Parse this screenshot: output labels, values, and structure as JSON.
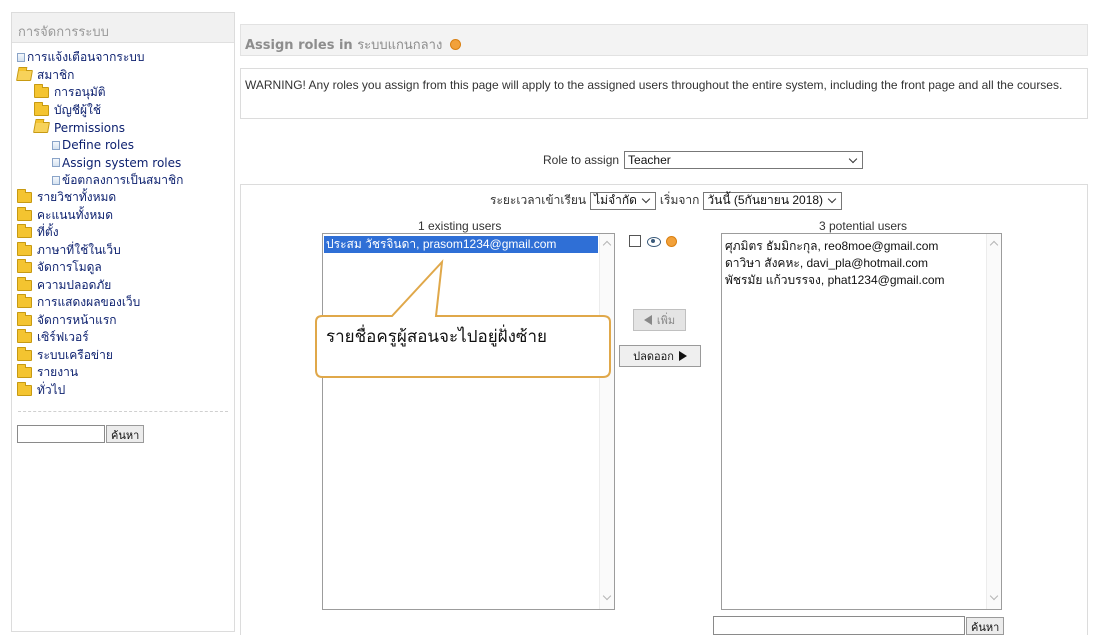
{
  "sidebar": {
    "title": "การจัดการระบบ",
    "items": [
      {
        "label": "การแจ้งเตือนจากระบบ",
        "level": "l0",
        "icon": "page-icon"
      },
      {
        "label": "สมาชิก",
        "level": "l0",
        "icon": "folder-open-icon"
      },
      {
        "label": "การอนุมัติ",
        "level": "l1",
        "icon": "folder-icon"
      },
      {
        "label": "บัญชีผู้ใช้",
        "level": "l1",
        "icon": "folder-icon"
      },
      {
        "label": "Permissions",
        "level": "l1",
        "icon": "folder-open-icon"
      },
      {
        "label": "Define roles",
        "level": "l2",
        "icon": "page-icon"
      },
      {
        "label": "Assign system roles",
        "level": "l2",
        "icon": "page-icon"
      },
      {
        "label": "ข้อตกลงการเป็นสมาชิก",
        "level": "l2",
        "icon": "page-icon"
      },
      {
        "label": "รายวิชาทั้งหมด",
        "level": "l0",
        "icon": "folder-icon"
      },
      {
        "label": "คะแนนทั้งหมด",
        "level": "l0",
        "icon": "folder-icon"
      },
      {
        "label": "ที่ตั้ง",
        "level": "l0",
        "icon": "folder-icon"
      },
      {
        "label": "ภาษาที่ใช้ในเว็บ",
        "level": "l0",
        "icon": "folder-icon"
      },
      {
        "label": "จัดการโมดูล",
        "level": "l0",
        "icon": "folder-icon"
      },
      {
        "label": "ความปลอดภัย",
        "level": "l0",
        "icon": "folder-icon"
      },
      {
        "label": "การแสดงผลของเว็บ",
        "level": "l0",
        "icon": "folder-icon"
      },
      {
        "label": "จัดการหน้าแรก",
        "level": "l0",
        "icon": "folder-icon"
      },
      {
        "label": "เซิร์ฟเวอร์",
        "level": "l0",
        "icon": "folder-icon"
      },
      {
        "label": "ระบบเครือข่าย",
        "level": "l0",
        "icon": "folder-icon"
      },
      {
        "label": "รายงาน",
        "level": "l0",
        "icon": "folder-icon"
      },
      {
        "label": "ทั่วไป",
        "level": "l0",
        "icon": "folder-icon"
      }
    ],
    "search_button": "ค้นหา"
  },
  "header": {
    "title_prefix": "Assign roles in",
    "title_context": "ระบบแกนกลาง"
  },
  "warning": "WARNING! Any roles you assign from this page will apply to the assigned users throughout the entire system, including the front page and all the courses.",
  "role": {
    "label": "Role to assign",
    "selected": "Teacher"
  },
  "enrol": {
    "period_label": "ระยะเวลาเข้าเรียน",
    "period_value": "ไม่จำกัด",
    "start_label": "เริ่มจาก",
    "start_value": "วันนี้ (5กันยายน 2018)"
  },
  "existing": {
    "caption": "1 existing users",
    "users": [
      "ประสม วัชรจินดา, prasom1234@gmail.com"
    ]
  },
  "potential": {
    "caption": "3 potential users",
    "users": [
      "ศุภมิตร ธัมมิกะกุล, reo8moe@gmail.com",
      "ดาวิษา สังคหะ, davi_pla@hotmail.com",
      "พัชรมัย แก้วบรรจง, phat1234@gmail.com"
    ],
    "search_button": "ค้นหา"
  },
  "buttons": {
    "add": "เพิ่ม",
    "remove": "ปลดออก"
  },
  "callout": {
    "text": "รายชื่อครูผู้สอนจะไปอยู่ฝั่งซ้าย"
  },
  "colors": {
    "link": "#0b1f6e",
    "selection": "#2f6fd6",
    "callout_border": "#e0a84a",
    "folder": "#f4c430"
  }
}
